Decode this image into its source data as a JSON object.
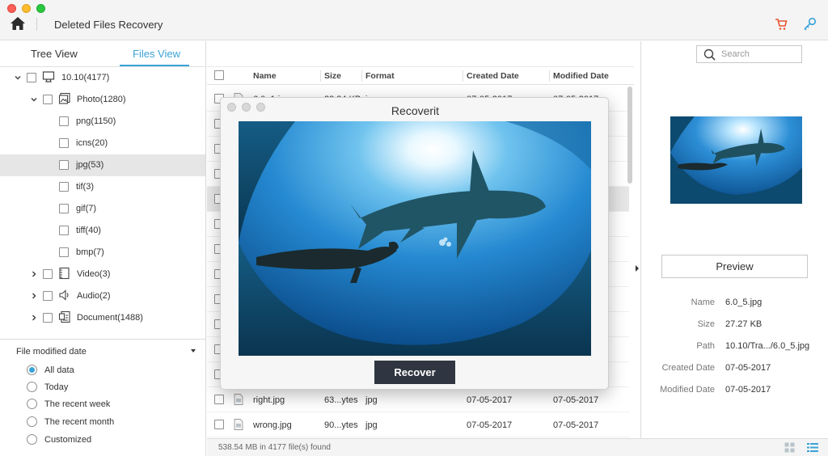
{
  "app": {
    "title": "Deleted Files Recovery"
  },
  "tabs": {
    "tree_view": "Tree View",
    "files_view": "Files View"
  },
  "tree": [
    {
      "label": "10.10(4177)",
      "icon": "computer-icon",
      "expand": "down"
    },
    {
      "label": "Photo(1280)",
      "icon": "photo-icon",
      "expand": "down"
    },
    {
      "label": "png(1150)",
      "icon": "",
      "expand": ""
    },
    {
      "label": "icns(20)",
      "icon": "",
      "expand": ""
    },
    {
      "label": "jpg(53)",
      "icon": "",
      "expand": ""
    },
    {
      "label": "tif(3)",
      "icon": "",
      "expand": ""
    },
    {
      "label": "gif(7)",
      "icon": "",
      "expand": ""
    },
    {
      "label": "tiff(40)",
      "icon": "",
      "expand": ""
    },
    {
      "label": "bmp(7)",
      "icon": "",
      "expand": ""
    },
    {
      "label": "Video(3)",
      "icon": "video-icon",
      "expand": "right"
    },
    {
      "label": "Audio(2)",
      "icon": "audio-icon",
      "expand": "right"
    },
    {
      "label": "Document(1488)",
      "icon": "document-icon",
      "expand": "right"
    }
  ],
  "filter": {
    "title": "File modified date",
    "options": [
      "All data",
      "Today",
      "The recent week",
      "The recent month",
      "Customized"
    ],
    "selected": "All data"
  },
  "search": {
    "placeholder": "Search"
  },
  "columns": {
    "name": "Name",
    "size": "Size",
    "format": "Format",
    "created": "Created Date",
    "modified": "Modified Date"
  },
  "files": [
    {
      "name": "6.0_1.jpg",
      "size": "23.84 KB",
      "format": "jpg",
      "created": "07-05-2017",
      "modified": "07-05-2017"
    },
    {
      "name": "",
      "size": "",
      "format": "",
      "created": "",
      "modified": ""
    },
    {
      "name": "",
      "size": "",
      "format": "",
      "created": "",
      "modified": ""
    },
    {
      "name": "",
      "size": "",
      "format": "",
      "created": "",
      "modified": ""
    },
    {
      "name": "",
      "size": "",
      "format": "",
      "created": "",
      "modified": ""
    },
    {
      "name": "",
      "size": "",
      "format": "",
      "created": "",
      "modified": ""
    },
    {
      "name": "",
      "size": "",
      "format": "",
      "created": "",
      "modified": ""
    },
    {
      "name": "",
      "size": "",
      "format": "",
      "created": "",
      "modified": ""
    },
    {
      "name": "",
      "size": "",
      "format": "",
      "created": "",
      "modified": ""
    },
    {
      "name": "",
      "size": "",
      "format": "",
      "created": "",
      "modified": ""
    },
    {
      "name": "",
      "size": "",
      "format": "",
      "created": "",
      "modified": ""
    },
    {
      "name": "",
      "size": "",
      "format": "",
      "created": "",
      "modified": ""
    },
    {
      "name": "right.jpg",
      "size": "63...ytes",
      "format": "jpg",
      "created": "07-05-2017",
      "modified": "07-05-2017"
    },
    {
      "name": "wrong.jpg",
      "size": "90...ytes",
      "format": "jpg",
      "created": "07-05-2017",
      "modified": "07-05-2017"
    }
  ],
  "status": {
    "summary": "538.54 MB in 4177 file(s) found"
  },
  "preview": {
    "button_label": "Preview",
    "info": [
      {
        "label": "Name",
        "value": "6.0_5.jpg"
      },
      {
        "label": "Size",
        "value": "27.27 KB"
      },
      {
        "label": "Path",
        "value": "10.10/Tra.../6.0_5.jpg"
      },
      {
        "label": "Created Date",
        "value": "07-05-2017"
      },
      {
        "label": "Modified Date",
        "value": "07-05-2017"
      }
    ]
  },
  "modal": {
    "title": "Recoverit",
    "recover_label": "Recover"
  },
  "colors": {
    "accent": "#3aa2d8",
    "recover_button": "#2f3641",
    "cart": "#e8542e",
    "selection": "#e6e6e6"
  }
}
